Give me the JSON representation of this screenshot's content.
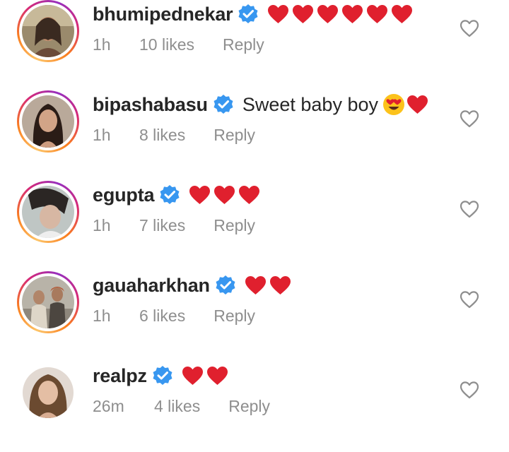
{
  "comments": [
    {
      "username": "bhumipednekar",
      "text": "",
      "hearts": 6,
      "emoji": [],
      "time": "1h",
      "likes": "10 likes",
      "reply_label": "Reply",
      "verified": true,
      "story_ring": true
    },
    {
      "username": "bipashabasu",
      "text": "Sweet baby boy",
      "hearts": 1,
      "emoji": [
        "heart-eyes-emoji"
      ],
      "time": "1h",
      "likes": "8 likes",
      "reply_label": "Reply",
      "verified": true,
      "story_ring": true
    },
    {
      "username": "egupta",
      "text": "",
      "hearts": 3,
      "emoji": [],
      "time": "1h",
      "likes": "7 likes",
      "reply_label": "Reply",
      "verified": true,
      "story_ring": true
    },
    {
      "username": "gauaharkhan",
      "text": "",
      "hearts": 2,
      "emoji": [],
      "time": "1h",
      "likes": "6 likes",
      "reply_label": "Reply",
      "verified": true,
      "story_ring": true
    },
    {
      "username": "realpz",
      "text": "",
      "hearts": 2,
      "emoji": [],
      "time": "26m",
      "likes": "4 likes",
      "reply_label": "Reply",
      "verified": true,
      "story_ring": false
    }
  ],
  "colors": {
    "username": "#262626",
    "meta": "#8e8e8e",
    "verified_badge": "#3897f0",
    "heart_emoji": "#e0202e",
    "like_outline": "#8e8e8e"
  },
  "icons": [
    "verified-badge-icon",
    "red-heart-emoji",
    "heart-eyes-emoji",
    "heart-outline-icon"
  ]
}
